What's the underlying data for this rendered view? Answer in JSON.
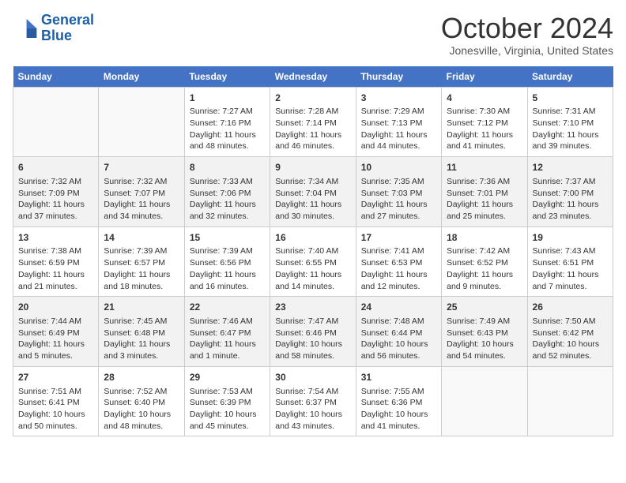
{
  "header": {
    "logo_line1": "General",
    "logo_line2": "Blue",
    "month": "October 2024",
    "location": "Jonesville, Virginia, United States"
  },
  "days_of_week": [
    "Sunday",
    "Monday",
    "Tuesday",
    "Wednesday",
    "Thursday",
    "Friday",
    "Saturday"
  ],
  "weeks": [
    [
      {
        "day": "",
        "info": ""
      },
      {
        "day": "",
        "info": ""
      },
      {
        "day": "1",
        "info": "Sunrise: 7:27 AM\nSunset: 7:16 PM\nDaylight: 11 hours and 48 minutes."
      },
      {
        "day": "2",
        "info": "Sunrise: 7:28 AM\nSunset: 7:14 PM\nDaylight: 11 hours and 46 minutes."
      },
      {
        "day": "3",
        "info": "Sunrise: 7:29 AM\nSunset: 7:13 PM\nDaylight: 11 hours and 44 minutes."
      },
      {
        "day": "4",
        "info": "Sunrise: 7:30 AM\nSunset: 7:12 PM\nDaylight: 11 hours and 41 minutes."
      },
      {
        "day": "5",
        "info": "Sunrise: 7:31 AM\nSunset: 7:10 PM\nDaylight: 11 hours and 39 minutes."
      }
    ],
    [
      {
        "day": "6",
        "info": "Sunrise: 7:32 AM\nSunset: 7:09 PM\nDaylight: 11 hours and 37 minutes."
      },
      {
        "day": "7",
        "info": "Sunrise: 7:32 AM\nSunset: 7:07 PM\nDaylight: 11 hours and 34 minutes."
      },
      {
        "day": "8",
        "info": "Sunrise: 7:33 AM\nSunset: 7:06 PM\nDaylight: 11 hours and 32 minutes."
      },
      {
        "day": "9",
        "info": "Sunrise: 7:34 AM\nSunset: 7:04 PM\nDaylight: 11 hours and 30 minutes."
      },
      {
        "day": "10",
        "info": "Sunrise: 7:35 AM\nSunset: 7:03 PM\nDaylight: 11 hours and 27 minutes."
      },
      {
        "day": "11",
        "info": "Sunrise: 7:36 AM\nSunset: 7:01 PM\nDaylight: 11 hours and 25 minutes."
      },
      {
        "day": "12",
        "info": "Sunrise: 7:37 AM\nSunset: 7:00 PM\nDaylight: 11 hours and 23 minutes."
      }
    ],
    [
      {
        "day": "13",
        "info": "Sunrise: 7:38 AM\nSunset: 6:59 PM\nDaylight: 11 hours and 21 minutes."
      },
      {
        "day": "14",
        "info": "Sunrise: 7:39 AM\nSunset: 6:57 PM\nDaylight: 11 hours and 18 minutes."
      },
      {
        "day": "15",
        "info": "Sunrise: 7:39 AM\nSunset: 6:56 PM\nDaylight: 11 hours and 16 minutes."
      },
      {
        "day": "16",
        "info": "Sunrise: 7:40 AM\nSunset: 6:55 PM\nDaylight: 11 hours and 14 minutes."
      },
      {
        "day": "17",
        "info": "Sunrise: 7:41 AM\nSunset: 6:53 PM\nDaylight: 11 hours and 12 minutes."
      },
      {
        "day": "18",
        "info": "Sunrise: 7:42 AM\nSunset: 6:52 PM\nDaylight: 11 hours and 9 minutes."
      },
      {
        "day": "19",
        "info": "Sunrise: 7:43 AM\nSunset: 6:51 PM\nDaylight: 11 hours and 7 minutes."
      }
    ],
    [
      {
        "day": "20",
        "info": "Sunrise: 7:44 AM\nSunset: 6:49 PM\nDaylight: 11 hours and 5 minutes."
      },
      {
        "day": "21",
        "info": "Sunrise: 7:45 AM\nSunset: 6:48 PM\nDaylight: 11 hours and 3 minutes."
      },
      {
        "day": "22",
        "info": "Sunrise: 7:46 AM\nSunset: 6:47 PM\nDaylight: 11 hours and 1 minute."
      },
      {
        "day": "23",
        "info": "Sunrise: 7:47 AM\nSunset: 6:46 PM\nDaylight: 10 hours and 58 minutes."
      },
      {
        "day": "24",
        "info": "Sunrise: 7:48 AM\nSunset: 6:44 PM\nDaylight: 10 hours and 56 minutes."
      },
      {
        "day": "25",
        "info": "Sunrise: 7:49 AM\nSunset: 6:43 PM\nDaylight: 10 hours and 54 minutes."
      },
      {
        "day": "26",
        "info": "Sunrise: 7:50 AM\nSunset: 6:42 PM\nDaylight: 10 hours and 52 minutes."
      }
    ],
    [
      {
        "day": "27",
        "info": "Sunrise: 7:51 AM\nSunset: 6:41 PM\nDaylight: 10 hours and 50 minutes."
      },
      {
        "day": "28",
        "info": "Sunrise: 7:52 AM\nSunset: 6:40 PM\nDaylight: 10 hours and 48 minutes."
      },
      {
        "day": "29",
        "info": "Sunrise: 7:53 AM\nSunset: 6:39 PM\nDaylight: 10 hours and 45 minutes."
      },
      {
        "day": "30",
        "info": "Sunrise: 7:54 AM\nSunset: 6:37 PM\nDaylight: 10 hours and 43 minutes."
      },
      {
        "day": "31",
        "info": "Sunrise: 7:55 AM\nSunset: 6:36 PM\nDaylight: 10 hours and 41 minutes."
      },
      {
        "day": "",
        "info": ""
      },
      {
        "day": "",
        "info": ""
      }
    ]
  ]
}
